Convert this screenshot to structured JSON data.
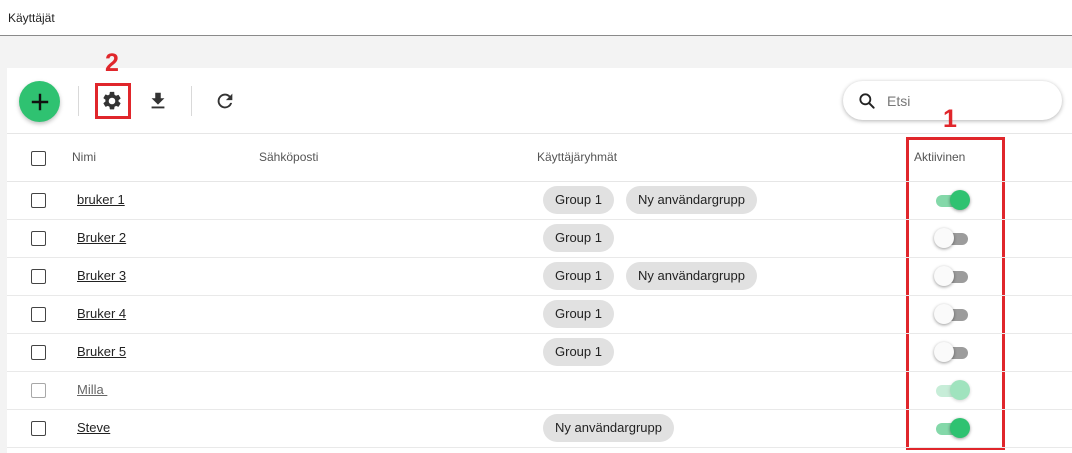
{
  "page": {
    "title": "Käyttäjät"
  },
  "toolbar": {
    "add_icon": "plus-icon",
    "settings_icon": "gear-icon",
    "download_icon": "download-icon",
    "refresh_icon": "refresh-icon"
  },
  "search": {
    "placeholder": "Etsi",
    "value": ""
  },
  "annotations": {
    "one": "1",
    "two": "2",
    "color": "#e0262b"
  },
  "table": {
    "headers": {
      "name": "Nimi",
      "email": "Sähköposti",
      "groups": "Käyttäjäryhmät",
      "active": "Aktiivinen"
    },
    "rows": [
      {
        "name": "bruker 1",
        "email": "",
        "groups": [
          "Group 1",
          "Ny användargrupp"
        ],
        "active": true,
        "disabled": false
      },
      {
        "name": "Bruker 2",
        "email": "",
        "groups": [
          "Group 1"
        ],
        "active": false,
        "disabled": false
      },
      {
        "name": "Bruker 3",
        "email": "",
        "groups": [
          "Group 1",
          "Ny användargrupp"
        ],
        "active": false,
        "disabled": false
      },
      {
        "name": "Bruker 4",
        "email": "",
        "groups": [
          "Group 1"
        ],
        "active": false,
        "disabled": false
      },
      {
        "name": "Bruker 5",
        "email": "",
        "groups": [
          "Group 1"
        ],
        "active": false,
        "disabled": false
      },
      {
        "name": "Milla ",
        "email": "",
        "groups": [],
        "active": true,
        "disabled": true
      },
      {
        "name": "Steve",
        "email": "",
        "groups": [
          "Ny användargrupp"
        ],
        "active": true,
        "disabled": false
      }
    ]
  },
  "colors": {
    "accent": "#2fc271",
    "toggle_on_track": "#84d8a9",
    "toggle_off_track": "#9c9c9c",
    "chip": "#e1e1e1"
  }
}
